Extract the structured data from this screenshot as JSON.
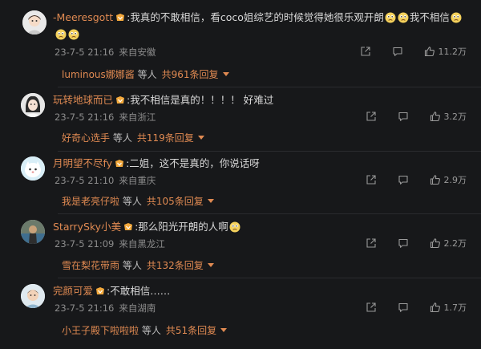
{
  "comments": [
    {
      "username": "-Meeresgott",
      "text_line1": ":我真的不敢相信，看coco姐综艺的时候觉得她很乐观开朗",
      "text_mid": "我不相信",
      "date": "23-7-5 21:16",
      "location": "来自安徽",
      "likes": "11.2万",
      "reply_user": "luminous娜娜酱",
      "reply_suffix": "等人",
      "reply_count": "共961条回复"
    },
    {
      "username": "玩转地球而已",
      "text_line1": ":我不相信是真的！！！！ 好难过",
      "date": "23-7-5 21:16",
      "location": "来自浙江",
      "likes": "3.2万",
      "reply_user": "好奇心选手",
      "reply_suffix": "等人",
      "reply_count": "共119条回复"
    },
    {
      "username": "月明望不尽fy",
      "text_line1": ":二姐，这不是真的，你说话呀",
      "date": "23-7-5 21:10",
      "location": "来自重庆",
      "likes": "2.9万",
      "reply_user": "我是老亮仔啦",
      "reply_suffix": "等人",
      "reply_count": "共105条回复"
    },
    {
      "username": "StarrySky小美",
      "text_line1": ":那么阳光开朗的人啊",
      "date": "23-7-5 21:09",
      "location": "来自黑龙江",
      "likes": "2.2万",
      "reply_user": "雪在梨花带雨",
      "reply_suffix": "等人",
      "reply_count": "共132条回复"
    },
    {
      "username": "完颜可爱",
      "text_line1": ":不敢相信……",
      "date": "23-7-5 21:16",
      "location": "来自湖南",
      "likes": "1.7万",
      "reply_user": "小王子殿下啦啦啦",
      "reply_suffix": "等人",
      "reply_count": "共51条回复"
    }
  ],
  "icons": {
    "share": "share-icon",
    "comment": "comment-icon",
    "like": "thumbs-up-icon",
    "vip": "vip-badge-icon",
    "emoji": "sad-emoji-icon"
  },
  "colors": {
    "background": "#17181a",
    "username": "#e08a52",
    "meta": "#8c8c8c",
    "vip": "#f3a93c"
  }
}
